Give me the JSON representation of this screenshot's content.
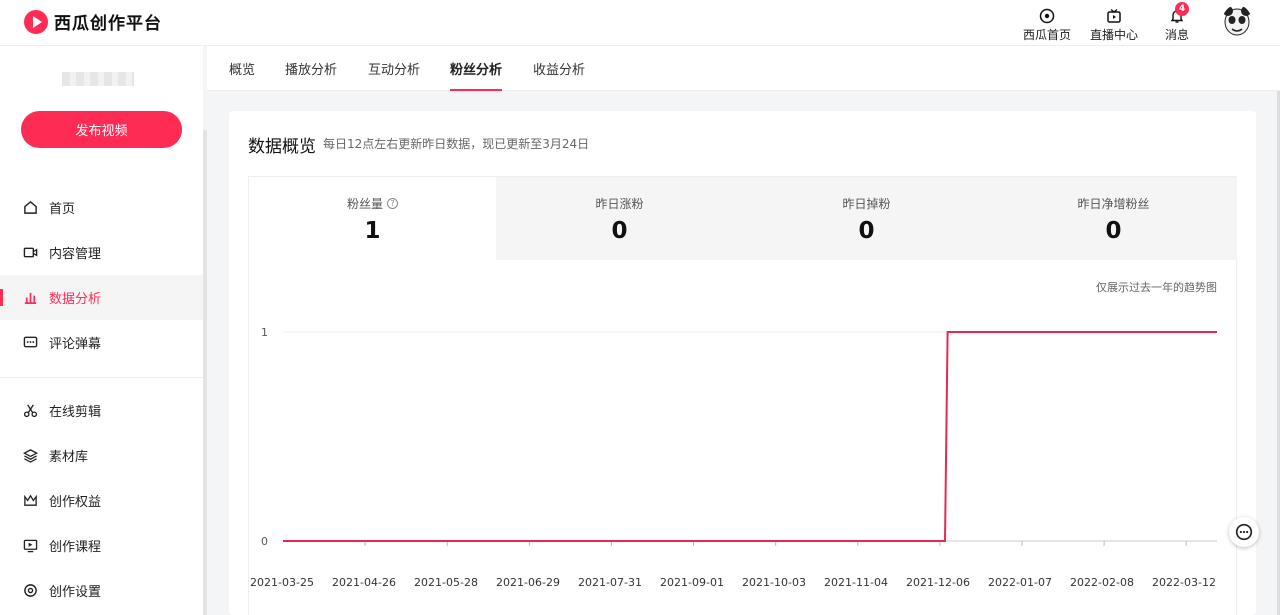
{
  "header": {
    "brand": "西瓜创作平台",
    "items": [
      {
        "label": "西瓜首页",
        "icon": "xigua-home-icon"
      },
      {
        "label": "直播中心",
        "icon": "tv-icon"
      },
      {
        "label": "消息",
        "icon": "bell-icon",
        "badge": "4"
      }
    ]
  },
  "sidebar": {
    "publish_label": "发布视频",
    "items": [
      {
        "label": "首页",
        "icon": "home-icon"
      },
      {
        "label": "内容管理",
        "icon": "video-icon"
      },
      {
        "label": "数据分析",
        "icon": "bar-chart-icon",
        "active": true
      },
      {
        "label": "评论弹幕",
        "icon": "comment-icon"
      },
      {
        "label": "在线剪辑",
        "icon": "scissors-icon"
      },
      {
        "label": "素材库",
        "icon": "layers-icon"
      },
      {
        "label": "创作权益",
        "icon": "crown-icon"
      },
      {
        "label": "创作课程",
        "icon": "course-icon"
      },
      {
        "label": "创作设置",
        "icon": "settings-icon"
      }
    ]
  },
  "tabs": [
    {
      "label": "概览"
    },
    {
      "label": "播放分析"
    },
    {
      "label": "互动分析"
    },
    {
      "label": "粉丝分析",
      "active": true
    },
    {
      "label": "收益分析"
    }
  ],
  "overview": {
    "title": "数据概览",
    "subtitle": "每日12点左右更新昨日数据，现已更新至3月24日",
    "stats": [
      {
        "label": "粉丝量",
        "value": "1",
        "active": true
      },
      {
        "label": "昨日涨粉",
        "value": "0"
      },
      {
        "label": "昨日掉粉",
        "value": "0"
      },
      {
        "label": "昨日净增粉丝",
        "value": "0"
      }
    ],
    "chart_note": "仅展示过去一年的趋势图"
  },
  "chart_data": {
    "type": "line",
    "x_ticks": [
      "2021-03-25",
      "2021-04-26",
      "2021-05-28",
      "2021-06-29",
      "2021-07-31",
      "2021-09-01",
      "2021-10-03",
      "2021-11-04",
      "2021-12-06",
      "2022-01-07",
      "2022-02-08",
      "2022-03-12"
    ],
    "y_ticks": [
      "0",
      "1"
    ],
    "ylim": [
      0,
      1
    ],
    "series": [
      {
        "points": [
          [
            "2021-03-25",
            0
          ],
          [
            "2021-12-08",
            0
          ],
          [
            "2021-12-09",
            1
          ],
          [
            "2022-03-24",
            1
          ]
        ]
      }
    ],
    "color": "#e8294f",
    "grid": true
  },
  "colors": {
    "accent": "#fe2c55"
  }
}
